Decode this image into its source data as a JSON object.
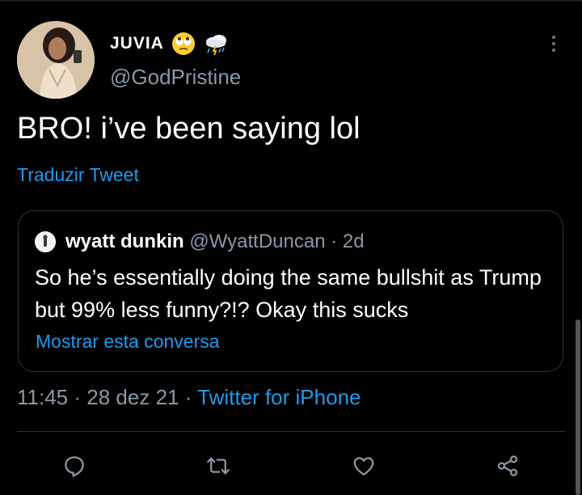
{
  "author": {
    "display_name": "JUVIA",
    "handle": "@GodPristine",
    "emojis": [
      "rolling-eyes-emoji",
      "cloud-with-lightning-and-rain-emoji"
    ]
  },
  "tweet": {
    "text": "BRO! i’ve been saying lol",
    "translate_label": "Traduzir Tweet"
  },
  "quoted": {
    "name": "wyatt dunkin",
    "handle": "@WyattDuncan",
    "separator": "·",
    "age": "2d",
    "text": "So he’s essentially doing the same bullshit as Trump but 99% less funny?!? Okay this sucks",
    "show_thread_label": "Mostrar esta conversa"
  },
  "meta": {
    "time": "11:45",
    "dot1": "·",
    "date": "28 dez 21",
    "dot2": "·",
    "source": "Twitter for iPhone"
  },
  "actions": [
    "reply-icon",
    "retweet-icon",
    "like-icon",
    "share-icon"
  ],
  "colors": {
    "background": "#000000",
    "link": "#1d9bf0",
    "secondary_text": "#8b98a5",
    "border": "#2f3336"
  }
}
